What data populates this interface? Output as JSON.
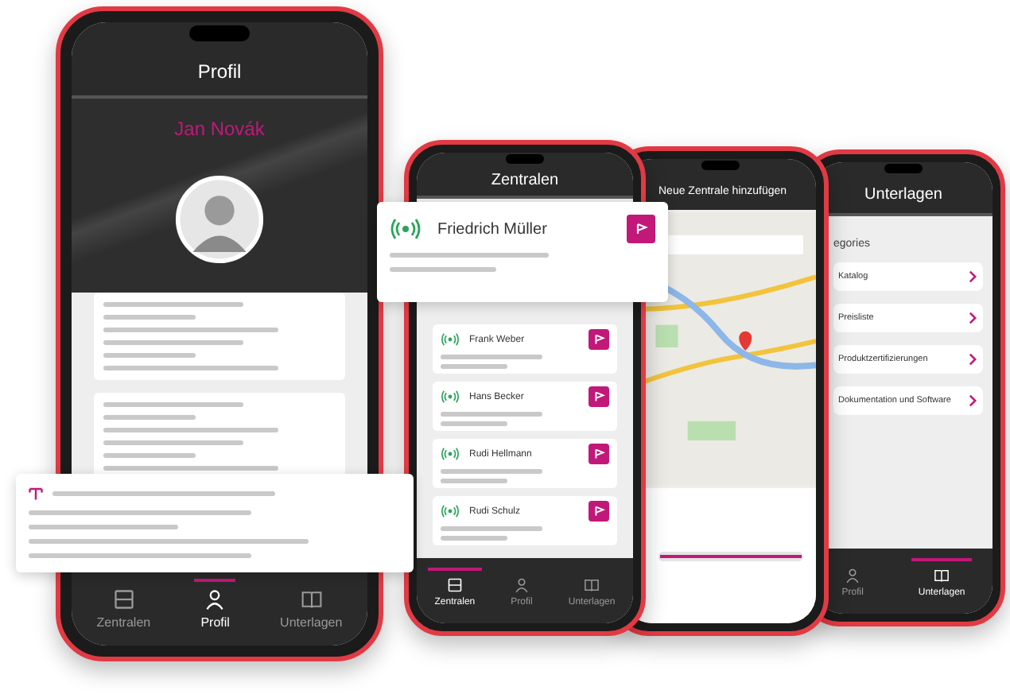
{
  "phones": [
    {
      "kind": "profile",
      "title": "Profil",
      "name": "Jan Novák",
      "tabs": [
        {
          "label": "Zentralen",
          "kind": "grid",
          "selected": false
        },
        {
          "label": "Profil",
          "kind": "person",
          "selected": true
        },
        {
          "label": "Unterlagen",
          "kind": "book",
          "selected": false
        }
      ]
    },
    {
      "kind": "list",
      "title": "Zentralen",
      "items": [
        {
          "name": "Frank Weber"
        },
        {
          "name": "Hans Becker"
        },
        {
          "name": "Rudi Hellmann"
        },
        {
          "name": "Rudi Schulz"
        }
      ],
      "tabs": [
        {
          "label": "Zentralen",
          "kind": "grid",
          "selected": true
        },
        {
          "label": "Profil",
          "kind": "person",
          "selected": false
        },
        {
          "label": "Unterlagen",
          "kind": "book",
          "selected": false
        }
      ]
    },
    {
      "kind": "map",
      "title": "Neue Zentrale hinzufügen",
      "progress": {
        "level": 1
      }
    },
    {
      "kind": "docs",
      "title": "Unterlagen",
      "section": "egories",
      "items": [
        "Katalog",
        "Preisliste",
        "Produktzertifizierungen",
        "Dokumentation und Software"
      ],
      "tabs": [
        {
          "label": "Profil",
          "kind": "person",
          "selected": false
        },
        {
          "label": "Unterlagen",
          "kind": "book",
          "selected": true
        }
      ]
    }
  ],
  "overlay_cards": [
    {
      "kind": "contact",
      "name": "Friedrich Müller"
    },
    {
      "kind": "info"
    }
  ]
}
